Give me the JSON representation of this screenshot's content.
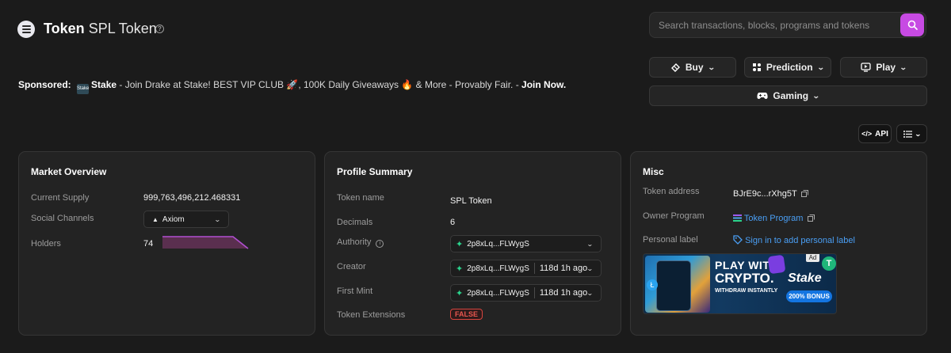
{
  "header": {
    "title_bold": "Token",
    "title_rest": "SPL Token",
    "search_placeholder": "Search transactions, blocks, programs and tokens"
  },
  "nav": {
    "buy": "Buy",
    "prediction": "Prediction",
    "play": "Play",
    "gaming": "Gaming",
    "api": "API"
  },
  "sponsored": {
    "label": "Sponsored:",
    "brand": "Stake",
    "badge": "Stake",
    "text_1": " - Join Drake at Stake! BEST VIP CLUB ",
    "emoji_1": "🚀",
    "text_2": ", 100K Daily Giveaways ",
    "emoji_2": "🔥",
    "text_3": " & More - Provably Fair. - ",
    "cta": "Join Now."
  },
  "market": {
    "title": "Market Overview",
    "supply_label": "Current Supply",
    "supply_value": "999,763,496,212.468331",
    "social_label": "Social Channels",
    "social_value": "Axiom",
    "holders_label": "Holders",
    "holders_value": "74"
  },
  "profile": {
    "title": "Profile Summary",
    "name_label": "Token name",
    "name_value": "SPL Token",
    "decimals_label": "Decimals",
    "decimals_value": "6",
    "authority_label": "Authority",
    "authority_value": "2p8xLq...FLWygS",
    "creator_label": "Creator",
    "creator_value": "2p8xLq...FLWygS",
    "creator_age": "118d 1h ago",
    "mint_label": "First Mint",
    "mint_value": "2p8xLq...FLWygS",
    "mint_age": "118d 1h ago",
    "extensions_label": "Token Extensions",
    "extensions_value": "FALSE"
  },
  "misc": {
    "title": "Misc",
    "address_label": "Token address",
    "address_value": "BJrE9c...rXhg5T",
    "owner_label": "Owner Program",
    "owner_value": "Token Program",
    "personal_label": "Personal label",
    "personal_link": "Sign in to add personal label"
  },
  "ad": {
    "tag": "Ad",
    "headline_1": "PLAY WITH",
    "headline_2": "CRYPTO.",
    "sub": "WITHDRAW INSTANTLY",
    "brand": "Stake",
    "bonus": "200% BONUS"
  },
  "colors": {
    "accent": "#c74ae3",
    "link": "#4a9ff5",
    "danger": "#e7564f"
  }
}
